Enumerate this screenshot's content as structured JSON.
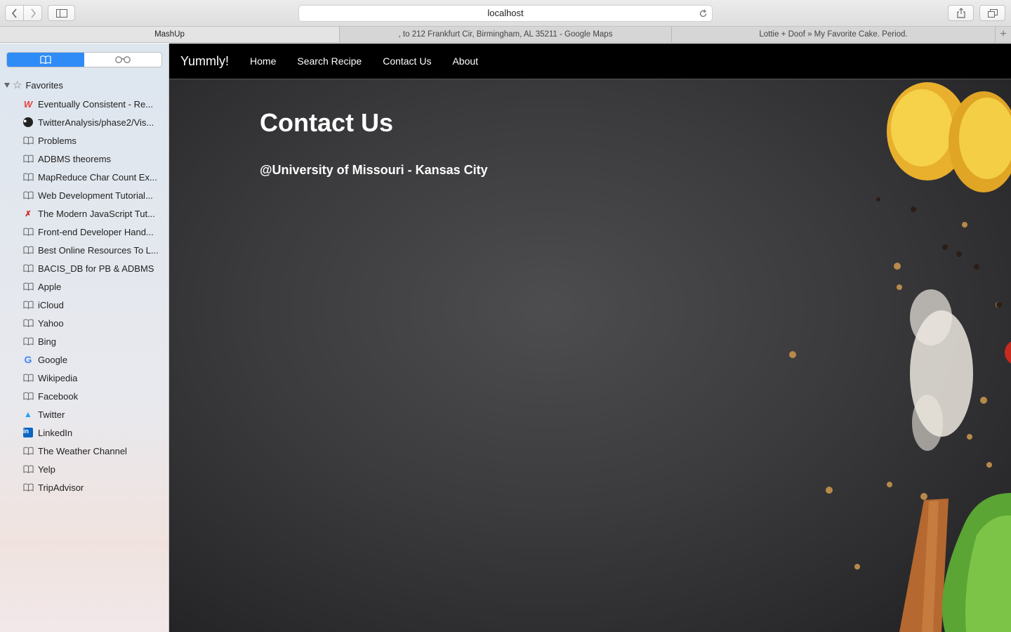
{
  "browser": {
    "address": "localhost",
    "tabs": [
      {
        "title": "MashUp"
      },
      {
        "title": ", to 212 Frankfurt Cir, Birmingham, AL 35211 - Google Maps"
      },
      {
        "title": "Lottie + Doof » My Favorite Cake. Period."
      }
    ],
    "new_tab": "+"
  },
  "sidebar": {
    "favorites_label": "Favorites",
    "bookmarks": [
      {
        "label": "Eventually Consistent - Re...",
        "icon": "w-icon"
      },
      {
        "label": "TwitterAnalysis/phase2/Vis...",
        "icon": "github-icon"
      },
      {
        "label": "Problems",
        "icon": "book-icon"
      },
      {
        "label": "ADBMS theorems",
        "icon": "book-icon"
      },
      {
        "label": "MapReduce Char Count Ex...",
        "icon": "book-icon"
      },
      {
        "label": "Web Development Tutorial...",
        "icon": "book-icon"
      },
      {
        "label": "The Modern JavaScript Tut...",
        "icon": "js-icon"
      },
      {
        "label": "Front-end Developer Hand...",
        "icon": "book-icon"
      },
      {
        "label": "Best Online Resources To L...",
        "icon": "book-icon"
      },
      {
        "label": "BACIS_DB for PB & ADBMS",
        "icon": "book-icon"
      },
      {
        "label": "Apple",
        "icon": "book-icon"
      },
      {
        "label": "iCloud",
        "icon": "book-icon"
      },
      {
        "label": "Yahoo",
        "icon": "book-icon"
      },
      {
        "label": "Bing",
        "icon": "book-icon"
      },
      {
        "label": "Google",
        "icon": "google-icon"
      },
      {
        "label": "Wikipedia",
        "icon": "book-icon"
      },
      {
        "label": "Facebook",
        "icon": "book-icon"
      },
      {
        "label": "Twitter",
        "icon": "twitter-icon"
      },
      {
        "label": "LinkedIn",
        "icon": "linkedin-icon"
      },
      {
        "label": "The Weather Channel",
        "icon": "book-icon"
      },
      {
        "label": "Yelp",
        "icon": "book-icon"
      },
      {
        "label": "TripAdvisor",
        "icon": "book-icon"
      }
    ]
  },
  "site": {
    "brand": "Yummly!",
    "nav": [
      {
        "label": "Home"
      },
      {
        "label": "Search Recipe"
      },
      {
        "label": "Contact Us"
      },
      {
        "label": "About"
      }
    ],
    "heading": "Contact Us",
    "contact_line": "@University of Missouri - Kansas City"
  }
}
